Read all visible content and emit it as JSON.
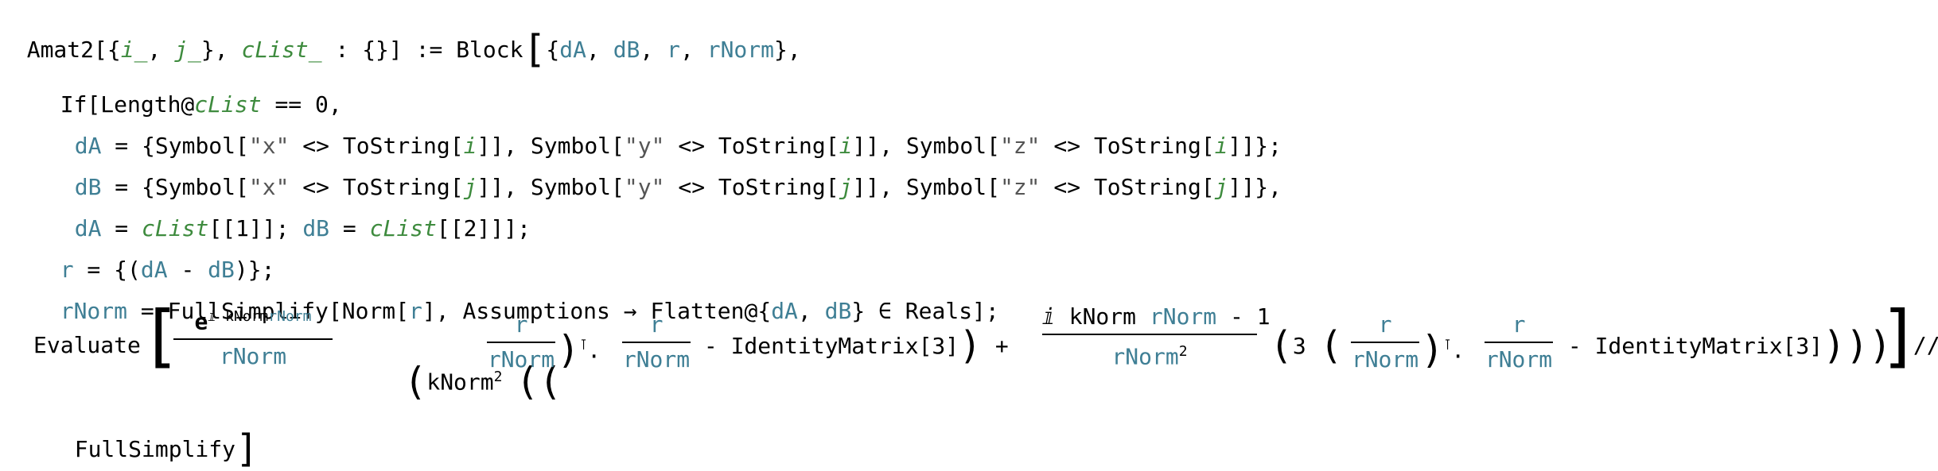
{
  "notebook": {
    "line1": {
      "head": "Amat2[{",
      "i": "i_",
      "comma1": ", ",
      "j": "j_",
      "close1": "}, ",
      "clist": "cList_",
      "colon": " : {}] := Block",
      "vars_open": "{",
      "dA": "dA",
      "dB": "dB",
      "r": "r",
      "rNorm": "rNorm",
      "vars_close": "},"
    },
    "line2": {
      "text": "If[Length@",
      "clist": "cList",
      "tail": " == 0,"
    },
    "line3": {
      "a": "dA",
      "b": " = {Symbol[",
      "s1": "\"x\"",
      "c": " <> ToString[",
      "i": "i",
      "d": "]], Symbol[",
      "s2": "\"y\"",
      "e": " <> ToString[",
      "i2": "i",
      "f": "]], Symbol[",
      "s3": "\"z\"",
      "g": " <> ToString[",
      "i3": "i",
      "h": "]]};"
    },
    "line4": {
      "a": "dB",
      "b": " = {Symbol[",
      "s1": "\"x\"",
      "c": " <> ToString[",
      "j": "j",
      "d": "]], Symbol[",
      "s2": "\"y\"",
      "e": " <> ToString[",
      "j2": "j",
      "f": "]], Symbol[",
      "s3": "\"z\"",
      "g": " <> ToString[",
      "j3": "j",
      "h": "]]},"
    },
    "line5": {
      "a": "dA",
      "b": " = ",
      "c1": "cList",
      "idx1": "[[1]]; ",
      "d": "dB",
      "e": " = ",
      "c2": "cList",
      "idx2": "[[2]]];"
    },
    "line6": {
      "a": "r",
      "b": " = {(",
      "c": "dA",
      "d": " - ",
      "e": "dB",
      "f": ")};"
    },
    "line7": {
      "a": "rNorm",
      "b": " = FullSimplify[Norm[",
      "c": "r",
      "d": "], Assumptions → Flatten@{",
      "e": "dA",
      "f": ", ",
      "g": "dB",
      "h": "} ∈ Reals];"
    },
    "line8": {
      "evaluate": "Evaluate",
      "exp_num": "e",
      "exp_sup_kn": "ⅈ kNorm",
      "exp_sup_rn": "rNorm",
      "exp_den": "rNorm",
      "kNorm2": "kNorm",
      "sq": "2",
      "r1": "r",
      "rn1": "rNorm",
      "T": "⊺",
      "dot": ".",
      "r2": "r",
      "rn2": "rNorm",
      "minus_id1": " - IdentityMatrix[3]",
      "plus": " + ",
      "frac2_num_a": "ⅈ kNorm ",
      "frac2_num_b": "rNorm",
      "frac2_num_c": " - 1",
      "frac2_den": "rNorm",
      "three": "3",
      "r3": "r",
      "rn3": "rNorm",
      "r4": "r",
      "rn4": "rNorm",
      "minus_id2": " - IdentityMatrix[3]",
      "tail": " //"
    },
    "line9": {
      "text": "FullSimplify"
    }
  }
}
